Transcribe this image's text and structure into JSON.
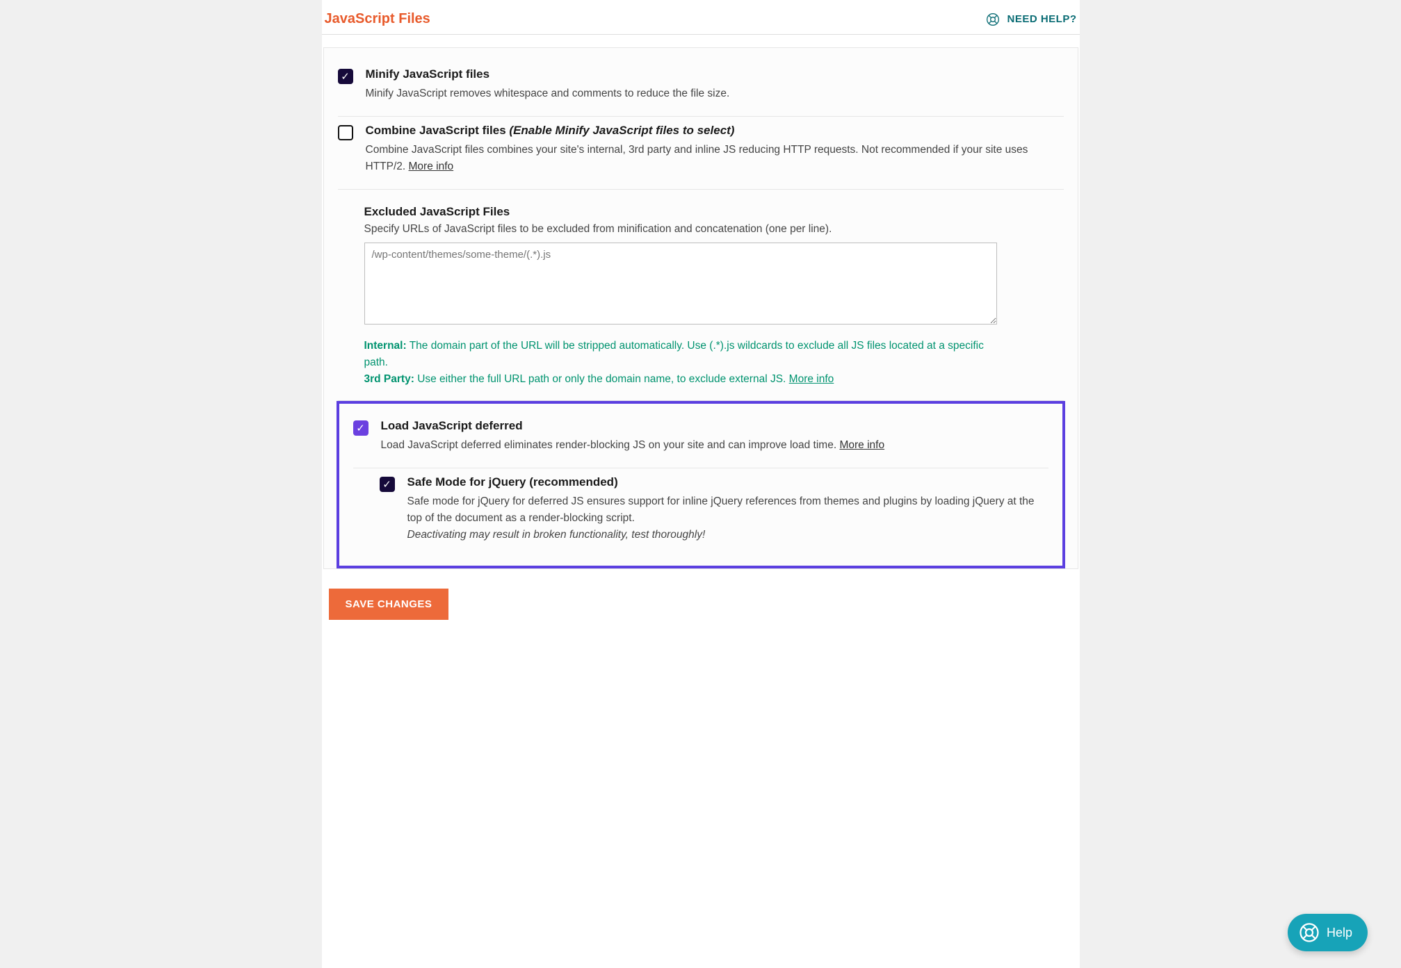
{
  "header": {
    "title": "JavaScript Files",
    "help_label": "NEED HELP?"
  },
  "options": {
    "minify": {
      "title": "Minify JavaScript files",
      "desc": "Minify JavaScript removes whitespace and comments to reduce the file size."
    },
    "combine": {
      "title": "Combine JavaScript files",
      "hint": "(Enable Minify JavaScript files to select)",
      "desc": "Combine JavaScript files combines your site's internal, 3rd party and inline JS reducing HTTP requests. Not recommended if your site uses HTTP/2.",
      "more": "More info"
    },
    "exclude": {
      "title": "Excluded JavaScript Files",
      "desc": "Specify URLs of JavaScript files to be excluded from minification and concatenation (one per line).",
      "placeholder": "/wp-content/themes/some-theme/(.*).js",
      "hint_internal_label": "Internal:",
      "hint_internal_text": "The domain part of the URL will be stripped automatically. Use (.*).js wildcards to exclude all JS files located at a specific path.",
      "hint_3p_label": "3rd Party:",
      "hint_3p_text": "Use either the full URL path or only the domain name, to exclude external JS.",
      "more": "More info"
    },
    "defer": {
      "title": "Load JavaScript deferred",
      "desc": "Load JavaScript deferred eliminates render-blocking JS on your site and can improve load time.",
      "more": "More info"
    },
    "safemode": {
      "title": "Safe Mode for jQuery (recommended)",
      "desc": "Safe mode for jQuery for deferred JS ensures support for inline jQuery references from themes and plugins by loading jQuery at the top of the document as a render-blocking script.",
      "warn": "Deactivating may result in broken functionality, test thoroughly!"
    }
  },
  "actions": {
    "save": "SAVE CHANGES"
  },
  "fab": {
    "label": "Help"
  }
}
